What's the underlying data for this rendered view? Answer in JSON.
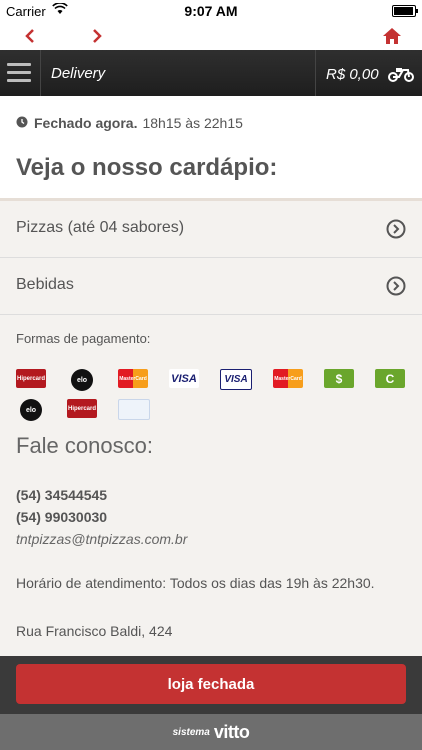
{
  "status_bar": {
    "carrier": "Carrier",
    "time": "9:07 AM",
    "battery_level": 0.95
  },
  "nav": {
    "back_icon": "chevron-left-icon",
    "forward_icon": "chevron-right-icon",
    "home_icon": "home-icon"
  },
  "header": {
    "title": "Delivery",
    "cart_total": "R$ 0,00"
  },
  "store": {
    "status": "Fechado agora.",
    "hours": "18h15 às 22h15"
  },
  "page_title": "Veja o nosso cardápio:",
  "menu": [
    {
      "label": "Pizzas (até 04 sabores)"
    },
    {
      "label": "Bebidas"
    }
  ],
  "payment": {
    "label": "Formas de pagamento:",
    "methods": [
      {
        "name": "Hipercard",
        "text": "Hipercard"
      },
      {
        "name": "Elo",
        "text": "elo"
      },
      {
        "name": "MasterCard",
        "text": "MasterCard"
      },
      {
        "name": "Visa",
        "text": "VISA"
      },
      {
        "name": "Visa Electron",
        "text": "VISA"
      },
      {
        "name": "MasterCard",
        "text": "MasterCard"
      },
      {
        "name": "Dinheiro",
        "text": "$"
      },
      {
        "name": "Cheque",
        "text": "C"
      },
      {
        "name": "Elo",
        "text": "elo"
      },
      {
        "name": "Hipercard",
        "text": "Hipercard"
      },
      {
        "name": "Outro",
        "text": ""
      }
    ]
  },
  "contact": {
    "title": "Fale conosco:",
    "phone1": "(54) 34544545",
    "phone2": "(54) 99030030",
    "email": "tntpizzas@tntpizzas.com.br",
    "hours": "Horário de atendimento: Todos os dias das 19h às 22h30.",
    "address": "Rua Francisco Baldi, 424"
  },
  "cta": {
    "label": "loja fechada"
  },
  "footer": {
    "prefix": "sistema",
    "brand": "vitto"
  },
  "colors": {
    "accent": "#c43232",
    "dark_bar": "#2b2b2b",
    "background": "#f4f2ef"
  }
}
